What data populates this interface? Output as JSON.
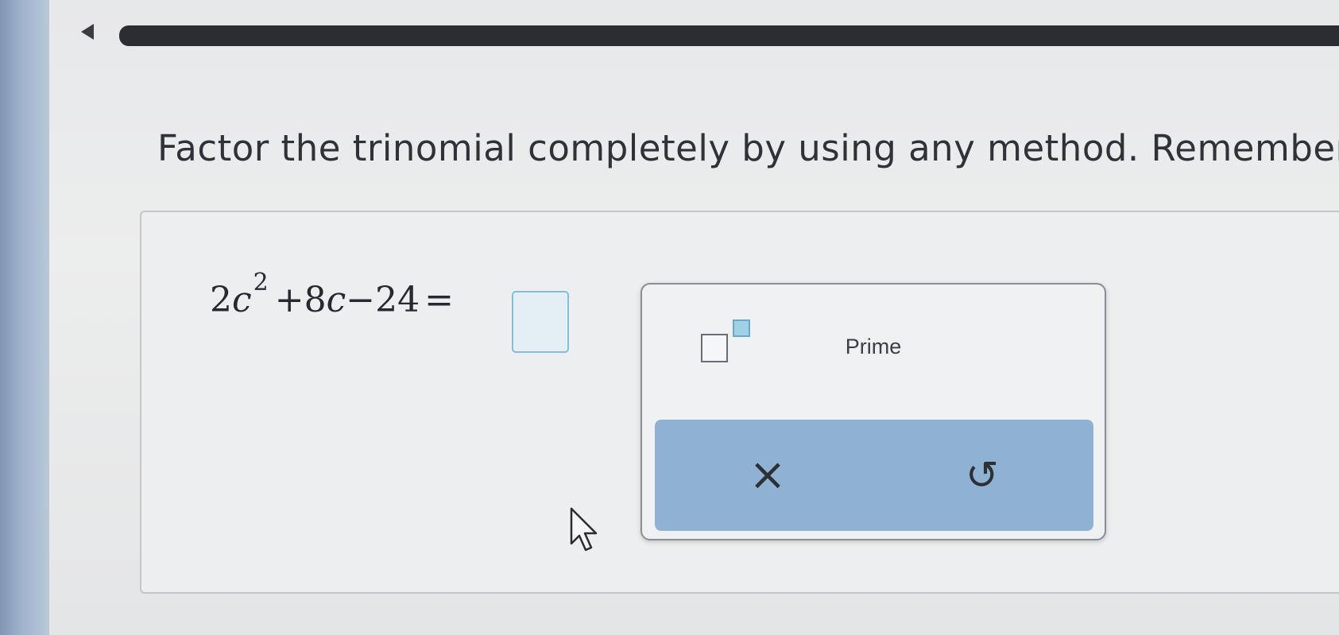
{
  "instruction": {
    "text": "Factor the trinomial completely by using any method. Remember t"
  },
  "equation": {
    "coef_a": "2",
    "variable": "c",
    "exponent": "2",
    "term_b": "+8",
    "variable_b": "c",
    "term_c": "−24",
    "equals": "="
  },
  "answer": {
    "value": ""
  },
  "keypad": {
    "exponent_icon": "exponent-template-icon",
    "prime_label": "Prime",
    "clear_symbol": "×",
    "clear_icon": "clear-icon",
    "undo_symbol": "↺",
    "undo_icon": "undo-icon"
  },
  "colors": {
    "action_bar": "#8fb2d3",
    "answer_box_border": "#7fbfdc",
    "progress_bar": "#2b2d33"
  }
}
